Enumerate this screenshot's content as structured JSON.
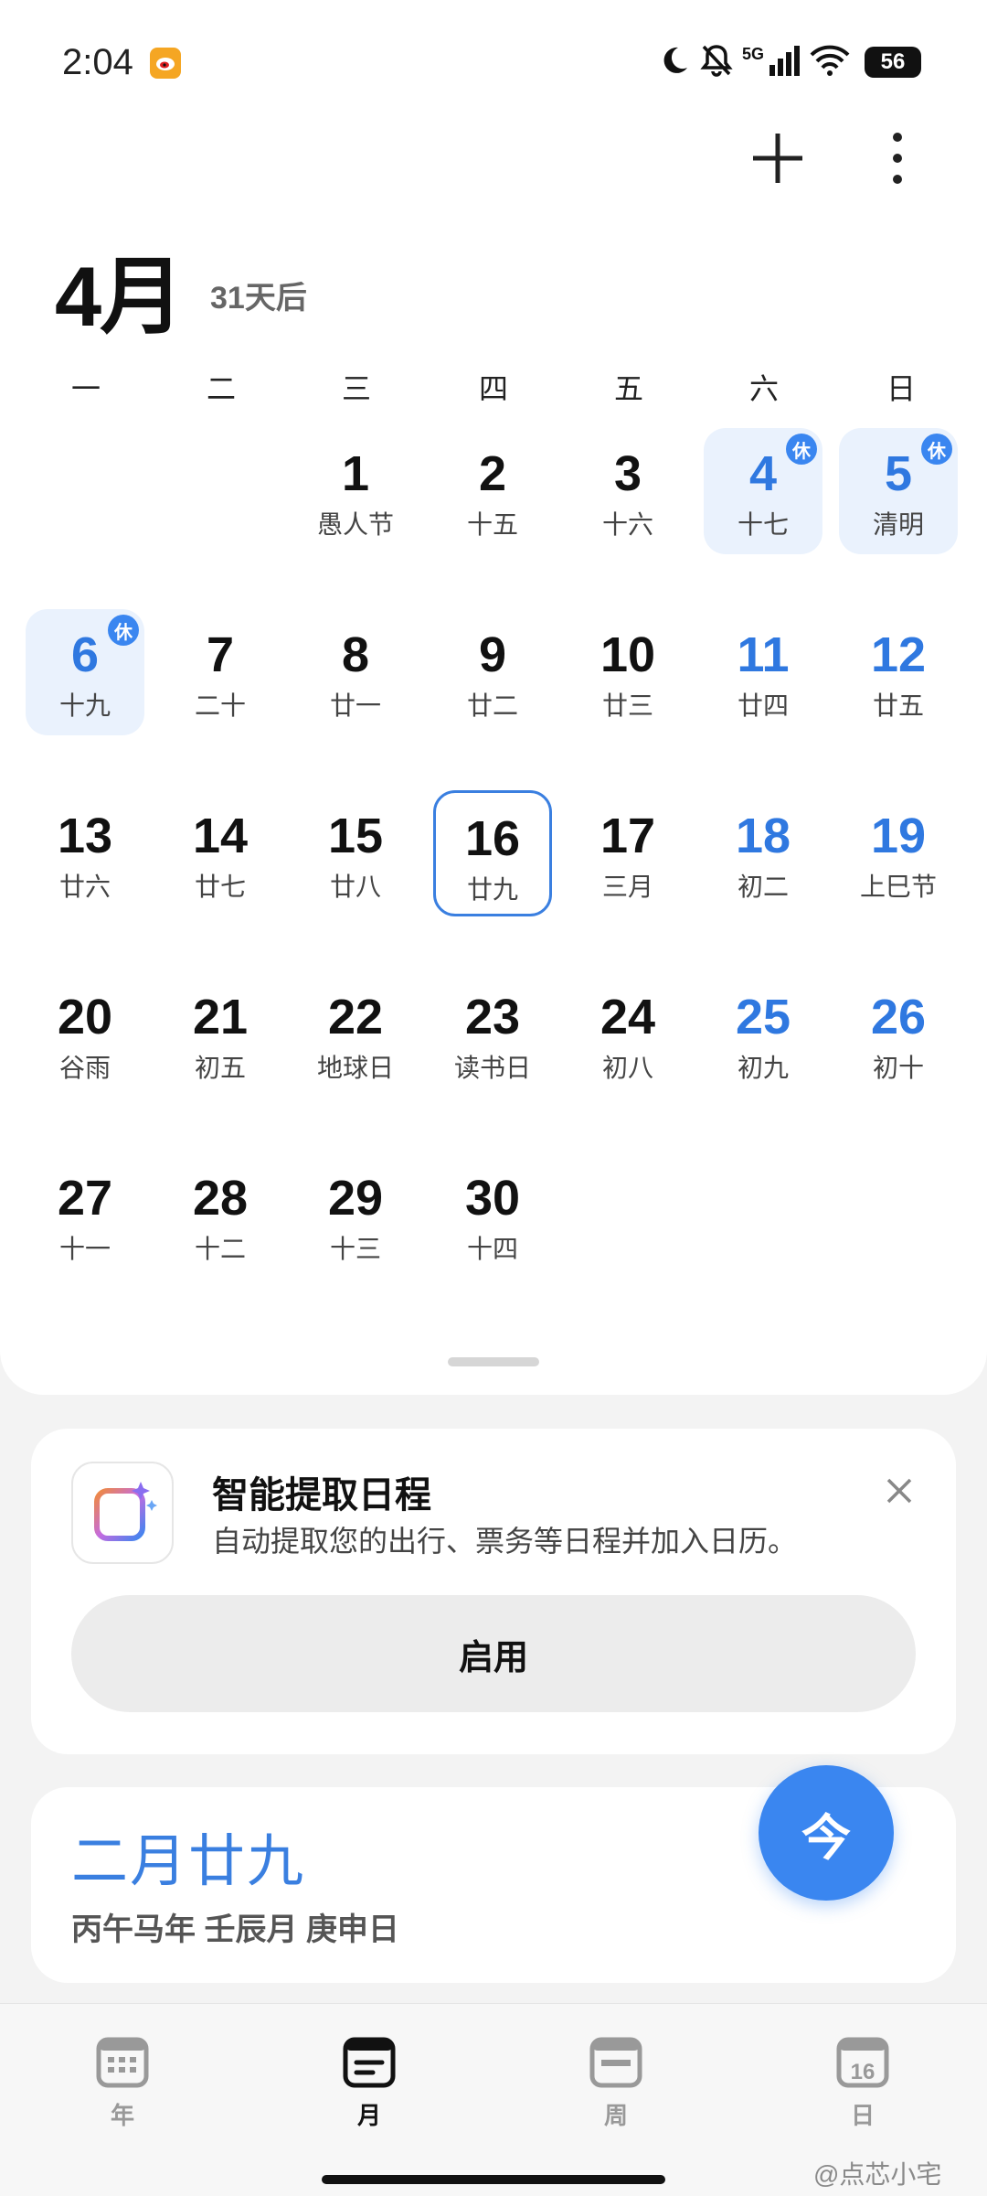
{
  "status_bar": {
    "time": "2:04",
    "network": "5G",
    "battery": "56"
  },
  "header": {
    "month": "4月",
    "countdown": "31天后"
  },
  "weekdays": [
    "一",
    "二",
    "三",
    "四",
    "五",
    "六",
    "日"
  ],
  "rest_label": "休",
  "days": [
    {
      "n": "1",
      "lunar": "愚人节"
    },
    {
      "n": "2",
      "lunar": "十五"
    },
    {
      "n": "3",
      "lunar": "十六"
    },
    {
      "n": "4",
      "lunar": "十七",
      "rest": true
    },
    {
      "n": "5",
      "lunar": "清明",
      "rest": true
    },
    {
      "n": "6",
      "lunar": "十九",
      "rest": true
    },
    {
      "n": "7",
      "lunar": "二十"
    },
    {
      "n": "8",
      "lunar": "廿一"
    },
    {
      "n": "9",
      "lunar": "廿二"
    },
    {
      "n": "10",
      "lunar": "廿三"
    },
    {
      "n": "11",
      "lunar": "廿四"
    },
    {
      "n": "12",
      "lunar": "廿五"
    },
    {
      "n": "13",
      "lunar": "廿六"
    },
    {
      "n": "14",
      "lunar": "廿七"
    },
    {
      "n": "15",
      "lunar": "廿八"
    },
    {
      "n": "16",
      "lunar": "廿九",
      "today": true
    },
    {
      "n": "17",
      "lunar": "三月"
    },
    {
      "n": "18",
      "lunar": "初二"
    },
    {
      "n": "19",
      "lunar": "上巳节"
    },
    {
      "n": "20",
      "lunar": "谷雨"
    },
    {
      "n": "21",
      "lunar": "初五"
    },
    {
      "n": "22",
      "lunar": "地球日"
    },
    {
      "n": "23",
      "lunar": "读书日"
    },
    {
      "n": "24",
      "lunar": "初八"
    },
    {
      "n": "25",
      "lunar": "初九"
    },
    {
      "n": "26",
      "lunar": "初十"
    },
    {
      "n": "27",
      "lunar": "十一"
    },
    {
      "n": "28",
      "lunar": "十二"
    },
    {
      "n": "29",
      "lunar": "十三"
    },
    {
      "n": "30",
      "lunar": "十四"
    }
  ],
  "smart_card": {
    "title": "智能提取日程",
    "description": "自动提取您的出行、票务等日程并加入日历。",
    "enable_label": "启用"
  },
  "lunar_card": {
    "date": "二月廿九",
    "ganzhi": "丙午马年 壬辰月 庚申日"
  },
  "today_button": "今",
  "nav": [
    {
      "label": "年",
      "icon": "year-grid-icon"
    },
    {
      "label": "月",
      "icon": "month-list-icon",
      "active": true
    },
    {
      "label": "周",
      "icon": "week-bar-icon"
    },
    {
      "label": "日",
      "icon": "day-calendar-icon",
      "day": "16"
    }
  ],
  "watermark": "@点芯小宅",
  "colors": {
    "accent": "#3a86f0",
    "holiday_bg": "#eaf2fd",
    "weekend_text": "#2f78e0"
  }
}
